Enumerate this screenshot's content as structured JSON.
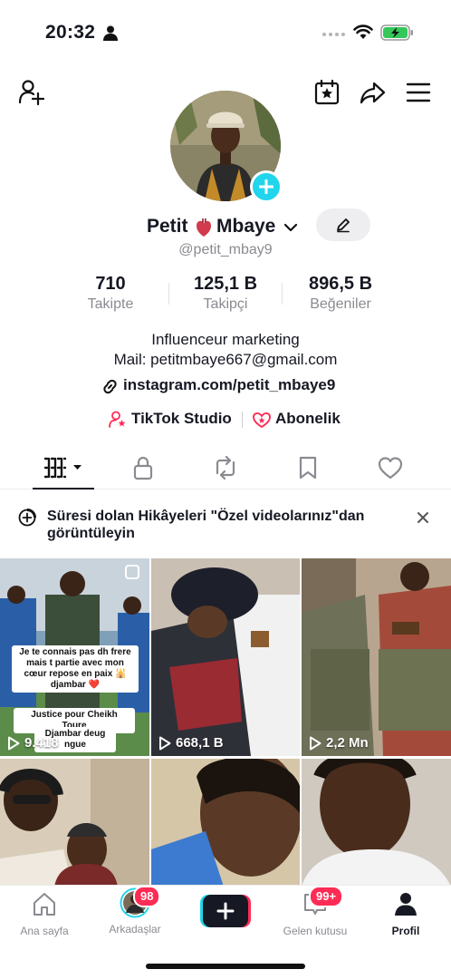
{
  "status_bar": {
    "time": "20:32"
  },
  "profile": {
    "name_prefix": "Petit",
    "name_suffix": "Mbaye",
    "handle": "@petit_mbay9",
    "stats": [
      {
        "value": "710",
        "label": "Takipte"
      },
      {
        "value": "125,1 B",
        "label": "Takipçi"
      },
      {
        "value": "896,5 B",
        "label": "Beğeniler"
      }
    ],
    "bio_line1": "Influenceur marketing",
    "bio_line2": "Mail: petitmbaye667@gmail.com",
    "link": "instagram.com/petit_mbaye9",
    "studio_label": "TikTok Studio",
    "subscription_label": "Abonelik"
  },
  "story_banner": {
    "text": "Süresi dolan Hikâyeleri \"Özel videolarınız\"dan görüntüleyin"
  },
  "videos": [
    {
      "views": "9.418",
      "overlay_text": "Je te connais pas dh frere mais t partie avec mon cœur repose en paix 🕌 djambar ❤️",
      "tag1": "Justice pour Cheikh Toure",
      "tag2": "Djambar deug ngue"
    },
    {
      "views": "668,1 B"
    },
    {
      "views": "2,2 Mn"
    },
    {
      "views": ""
    },
    {
      "views": ""
    },
    {
      "views": ""
    }
  ],
  "bottom_nav": {
    "home": "Ana sayfa",
    "friends": "Arkadaşlar",
    "friends_badge": "98",
    "inbox": "Gelen kutusu",
    "inbox_badge": "99+",
    "profile": "Profil"
  },
  "colors": {
    "accent_cyan": "#20d5ec",
    "accent_red": "#fe2c55",
    "text_primary": "#161823",
    "text_secondary": "#8a8b91"
  }
}
